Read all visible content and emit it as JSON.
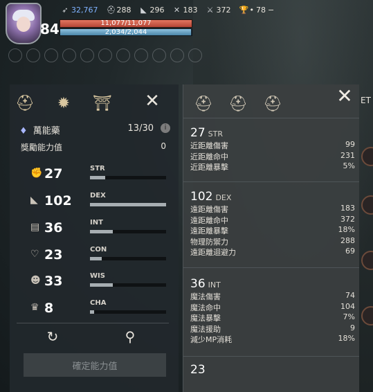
{
  "hud": {
    "level": "84",
    "resources": [
      {
        "icon": "feather-icon",
        "value": "32,767",
        "color": "#7fb2ff"
      },
      {
        "icon": "helmet-icon",
        "value": "288"
      },
      {
        "icon": "boot-icon",
        "value": "296"
      },
      {
        "icon": "swords-icon",
        "value": "183"
      },
      {
        "icon": "crossed-swords-icon",
        "value": "372"
      },
      {
        "icon": "trophy-icon",
        "value": "78"
      }
    ],
    "trophy_prefix": "•",
    "hp_text": "11,077/11,077",
    "mp_text": "2,034/2,044",
    "hp_ratio": 1.0,
    "mp_ratio": 0.995
  },
  "left_panel": {
    "tabs": [
      "helmet-tab-icon",
      "star-burst-tab-icon",
      "shrine-tab-icon"
    ],
    "elixir_label": "萬能藥",
    "elixir_count": "13/30",
    "elixir_info": "i",
    "bonus_label": "獎勵能力值",
    "bonus_value": "0",
    "stats": [
      {
        "icon": "fist-icon",
        "value": "27",
        "name": "STR",
        "fill": 0.2
      },
      {
        "icon": "boot-icon",
        "value": "102",
        "name": "DEX",
        "fill": 1.0
      },
      {
        "icon": "book-icon",
        "value": "36",
        "name": "INT",
        "fill": 0.3
      },
      {
        "icon": "heart-icon",
        "value": "23",
        "name": "CON",
        "fill": 0.15
      },
      {
        "icon": "head-icon",
        "value": "33",
        "name": "WIS",
        "fill": 0.3
      },
      {
        "icon": "crown-icon",
        "value": "8",
        "name": "CHA",
        "fill": 0.05
      }
    ],
    "confirm_label": "確定能力值"
  },
  "right_panel": {
    "sections": [
      {
        "value": "27",
        "abbr": "STR",
        "rows": [
          {
            "label": "近距離傷害",
            "value": "99"
          },
          {
            "label": "近距離命中",
            "value": "231"
          },
          {
            "label": "近距離暴擊",
            "value": "5%"
          }
        ]
      },
      {
        "value": "102",
        "abbr": "DEX",
        "rows": [
          {
            "label": "遠距離傷害",
            "value": "183"
          },
          {
            "label": "遠距離命中",
            "value": "372"
          },
          {
            "label": "遠距離暴擊",
            "value": "18%"
          },
          {
            "label": "物理防禦力",
            "value": "288"
          },
          {
            "label": "遠距離迴避力",
            "value": "69"
          }
        ]
      },
      {
        "value": "36",
        "abbr": "INT",
        "rows": [
          {
            "label": "魔法傷害",
            "value": "74"
          },
          {
            "label": "魔法命中",
            "value": "104"
          },
          {
            "label": "魔法暴擊",
            "value": "7%"
          },
          {
            "label": "魔法援助",
            "value": "9"
          },
          {
            "label": "減少MP消耗",
            "value": "18%"
          }
        ]
      }
    ],
    "next_section_partial": "23"
  },
  "edge_text": "ET"
}
